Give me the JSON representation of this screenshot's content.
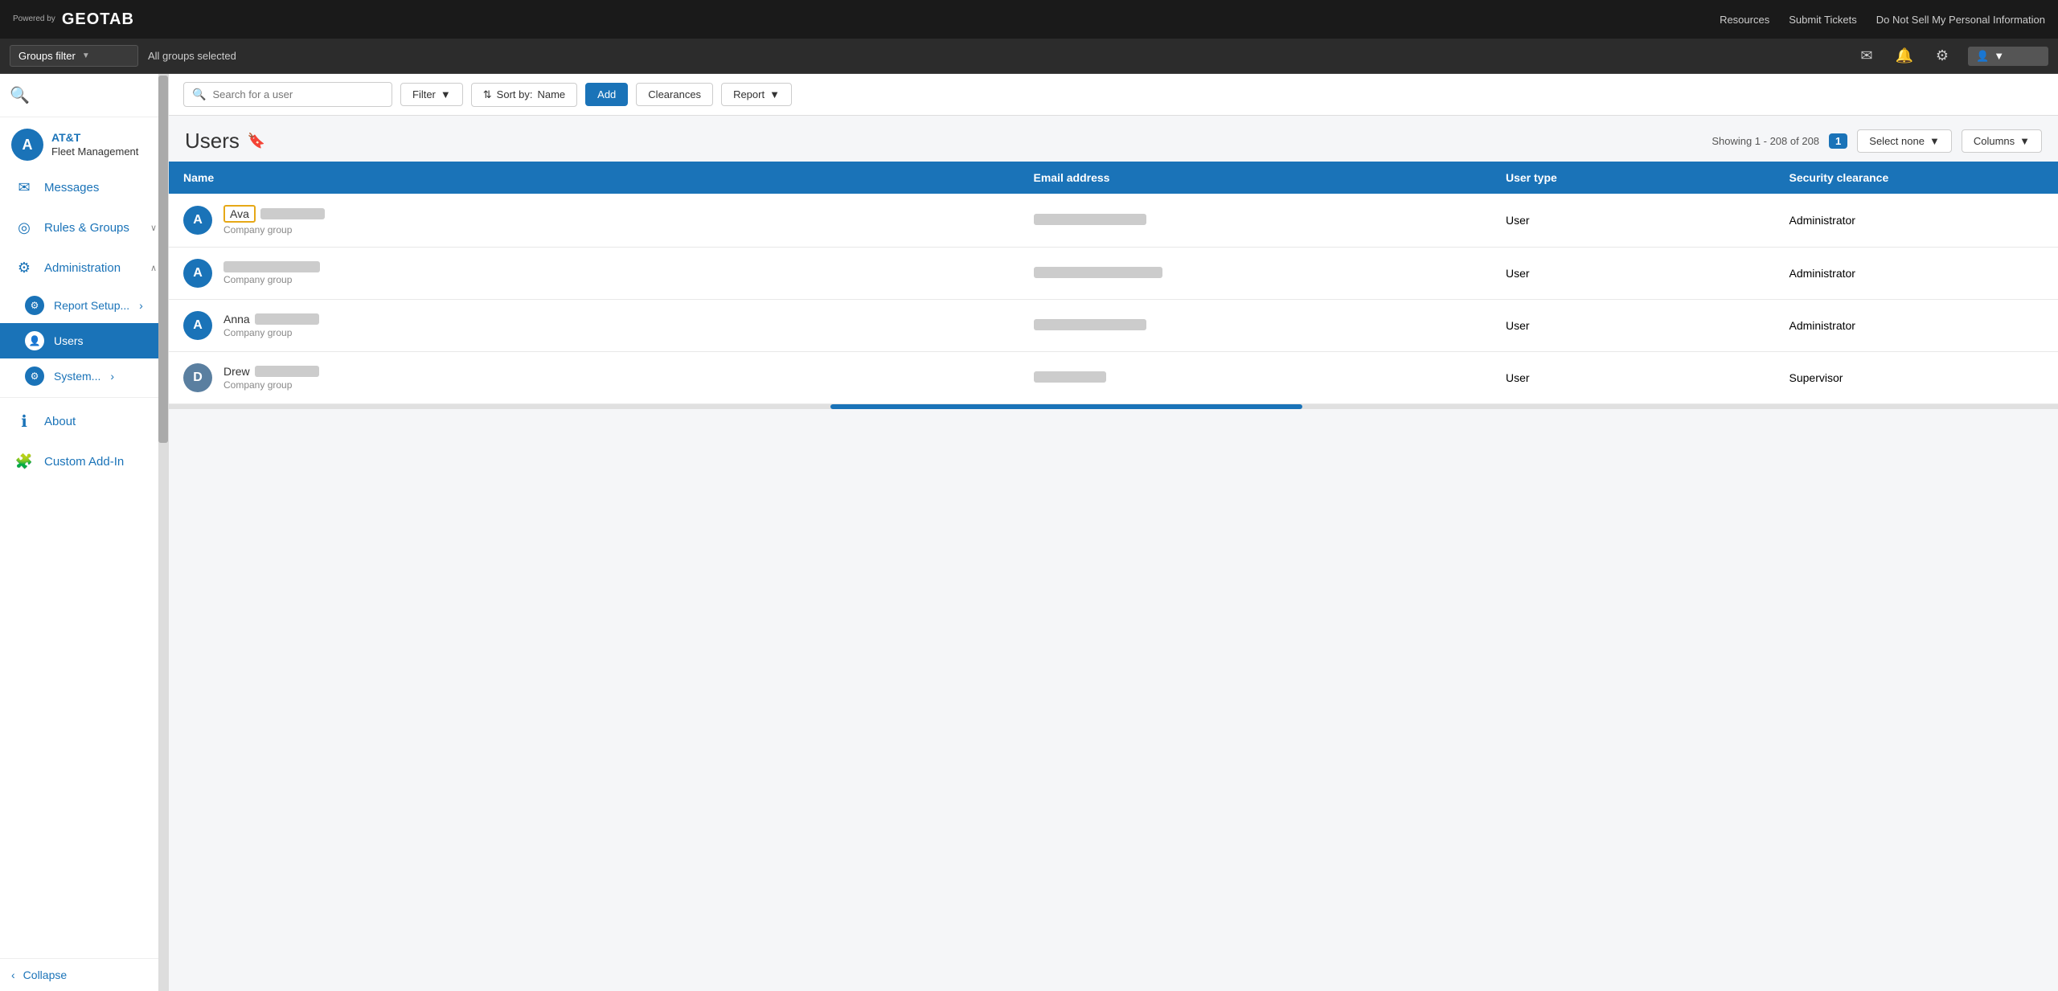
{
  "topnav": {
    "powered_by": "Powered by",
    "brand": "GEOTAB",
    "links": [
      "Resources",
      "Submit Tickets",
      "Do Not Sell My Personal Information"
    ]
  },
  "groups_bar": {
    "filter_label": "Groups filter",
    "all_groups": "All groups selected"
  },
  "sidebar": {
    "brand_name": "AT&T",
    "brand_sub": "Fleet Management",
    "brand_letter": "A",
    "items": [
      {
        "id": "messages",
        "label": "Messages",
        "icon": "✉"
      },
      {
        "id": "rules-groups",
        "label": "Rules & Groups",
        "icon": "◎",
        "chevron": "∨"
      },
      {
        "id": "administration",
        "label": "Administration",
        "icon": "⚙",
        "chevron": "∧",
        "active": false
      },
      {
        "id": "report-setup",
        "label": "Report Setup...",
        "icon": "⚙",
        "sub": true,
        "chevron": "›"
      },
      {
        "id": "users",
        "label": "Users",
        "icon": "👤",
        "sub": true,
        "active": true
      },
      {
        "id": "system",
        "label": "System...",
        "icon": "⚙",
        "sub": true,
        "chevron": "›"
      },
      {
        "id": "about",
        "label": "About",
        "icon": "ℹ"
      },
      {
        "id": "custom-addon",
        "label": "Custom Add-In",
        "icon": "🧩"
      }
    ],
    "collapse_label": "Collapse"
  },
  "toolbar": {
    "search_placeholder": "Search for a user",
    "filter_label": "Filter",
    "sort_label": "Sort by:",
    "sort_value": "Name",
    "add_label": "Add",
    "clearances_label": "Clearances",
    "report_label": "Report"
  },
  "page": {
    "title": "Users",
    "showing_prefix": "Showing 1 - 208 of",
    "showing_total": "208",
    "page_badge": "1",
    "select_none_label": "Select none",
    "columns_label": "Columns"
  },
  "table": {
    "columns": [
      "Name",
      "Email address",
      "User type",
      "Security clearance"
    ],
    "rows": [
      {
        "initial": "A",
        "name_highlighted": "Ava",
        "name_blur": true,
        "group": "Company group",
        "email_blur": true,
        "email_width": "140",
        "user_type": "User",
        "security": "Administrator",
        "avatar_color": "blue"
      },
      {
        "initial": "A",
        "name_blur": true,
        "name_only_blur": true,
        "group": "Company group",
        "email_blur": true,
        "email_width": "160",
        "user_type": "User",
        "security": "Administrator",
        "avatar_color": "blue"
      },
      {
        "initial": "A",
        "name_prefix": "Anna",
        "name_blur": true,
        "group": "Company group",
        "email_blur": true,
        "email_width": "140",
        "user_type": "User",
        "security": "Administrator",
        "avatar_color": "blue"
      },
      {
        "initial": "D",
        "name_prefix": "Drew",
        "name_blur": true,
        "group": "Company group",
        "email_blur": true,
        "email_width": "90",
        "user_type": "User",
        "security": "Supervisor",
        "avatar_color": "steel"
      }
    ]
  }
}
